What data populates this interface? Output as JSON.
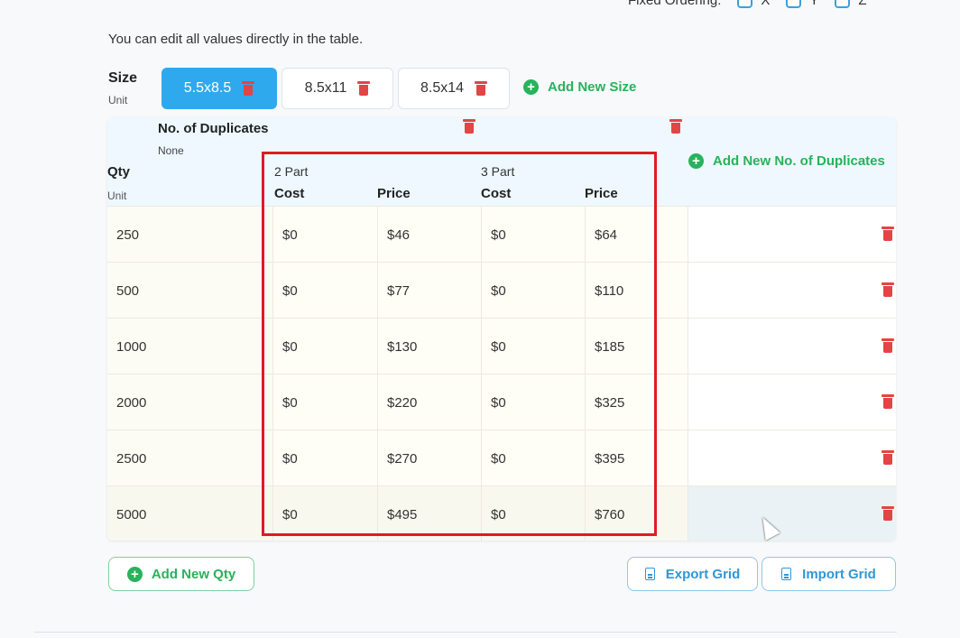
{
  "fixed_ordering": {
    "label": "Fixed Ordering:",
    "options": [
      "X",
      "Y",
      "Z"
    ]
  },
  "intro_text": "You can edit all values directly in the table.",
  "size": {
    "label": "Size",
    "unit": "Unit",
    "chips": [
      "5.5x8.5",
      "8.5x11",
      "8.5x14"
    ],
    "active_chip": "5.5x8.5",
    "add_label": "Add New Size"
  },
  "table": {
    "duplicates_label": "No. of Duplicates",
    "duplicates_unit": "None",
    "qty_label": "Qty",
    "qty_unit": "Unit",
    "add_duplicates_label": "Add New No. of Duplicates",
    "groups": [
      {
        "name": "2 Part",
        "cost_label": "Cost",
        "price_label": "Price"
      },
      {
        "name": "3 Part",
        "cost_label": "Cost",
        "price_label": "Price"
      }
    ],
    "rows": [
      {
        "qty": "250",
        "cost1": "$0",
        "price1": "$46",
        "cost2": "$0",
        "price2": "$64"
      },
      {
        "qty": "500",
        "cost1": "$0",
        "price1": "$77",
        "cost2": "$0",
        "price2": "$110"
      },
      {
        "qty": "1000",
        "cost1": "$0",
        "price1": "$130",
        "cost2": "$0",
        "price2": "$185"
      },
      {
        "qty": "2000",
        "cost1": "$0",
        "price1": "$220",
        "cost2": "$0",
        "price2": "$325"
      },
      {
        "qty": "2500",
        "cost1": "$0",
        "price1": "$270",
        "cost2": "$0",
        "price2": "$395"
      },
      {
        "qty": "5000",
        "cost1": "$0",
        "price1": "$495",
        "cost2": "$0",
        "price2": "$760"
      }
    ]
  },
  "buttons": {
    "add_qty": "Add New Qty",
    "export_grid": "Export Grid",
    "import_grid": "Import Grid"
  },
  "colors": {
    "accent_blue": "#2fa9ee",
    "accent_green": "#27b35b",
    "delete_red": "#e24545",
    "highlight_red": "#e01b24"
  }
}
